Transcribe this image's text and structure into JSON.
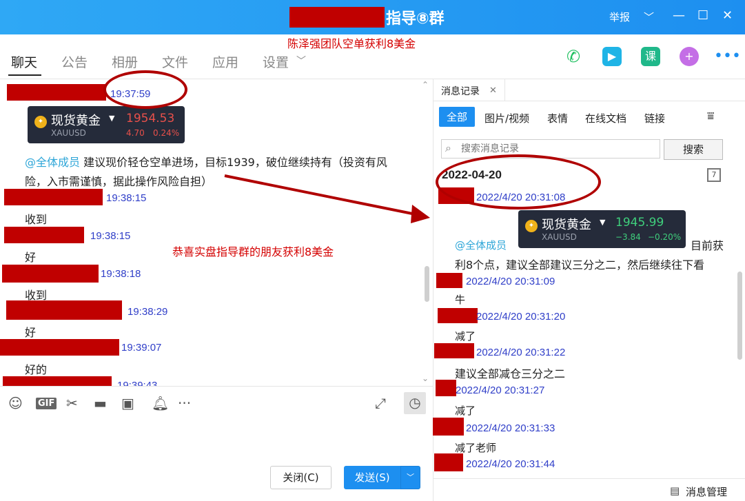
{
  "window": {
    "title": "指导⑧群",
    "report_label": "举报",
    "caption_overlay": "陈泽强团队空单获利8美金"
  },
  "nav": {
    "tabs": [
      "聊天",
      "公告",
      "相册",
      "文件",
      "应用",
      "设置"
    ]
  },
  "chat": {
    "msg1_time": "19:37:59",
    "card1": {
      "name": "现货黄金",
      "symbol": "XAUUSD",
      "price": "1954.53",
      "change": "4.70",
      "change_pct": "0.24%"
    },
    "mention": "@全体成员",
    "msg1_line1": "建议现价轻仓空单进场，目标1939，破位继续持有（投资有风",
    "msg1_line2": "险，入市需谨慎，据此操作风险自担）",
    "entries": [
      {
        "time": "19:38:15",
        "text": "收到"
      },
      {
        "time": "19:38:15",
        "text": "好"
      },
      {
        "time": "19:38:18",
        "text": "收到"
      },
      {
        "time": "19:38:29",
        "text": "好"
      },
      {
        "time": "19:39:07",
        "text": "好的"
      },
      {
        "time": "19:39:43",
        "text": ""
      }
    ],
    "annotation": "恭喜实盘指导群的朋友获利8美金"
  },
  "input": {
    "close_label": "关闭(C)",
    "send_label": "发送(S)"
  },
  "history": {
    "tab_label": "消息记录",
    "filters": [
      "全部",
      "图片/视频",
      "表情",
      "在线文档",
      "链接"
    ],
    "search_placeholder": "搜索消息记录",
    "search_button": "搜索",
    "date": "2022-04-20",
    "first_time": "2022/4/20 20:31:08",
    "card2": {
      "name": "现货黄金",
      "symbol": "XAUUSD",
      "price": "1945.99",
      "change": "−3.84",
      "change_pct": "−0.20%"
    },
    "mention": "@全体成员",
    "msg_tail": "目前获",
    "msg_line2": "利8个点，建议全部建议三分之二，然后继续往下看",
    "entries": [
      {
        "time": "2022/4/20 20:31:09",
        "text": "牛"
      },
      {
        "time": "2022/4/20 20:31:20",
        "text": "减了"
      },
      {
        "time": "2022/4/20 20:31:22",
        "text": "建议全部减仓三分之二"
      },
      {
        "time": "2022/4/20 20:31:27",
        "text": "减了"
      },
      {
        "time": "2022/4/20 20:31:33",
        "text": "减了老师"
      },
      {
        "time": "2022/4/20 20:31:44",
        "text": ""
      }
    ],
    "manage_label": "消息管理"
  }
}
